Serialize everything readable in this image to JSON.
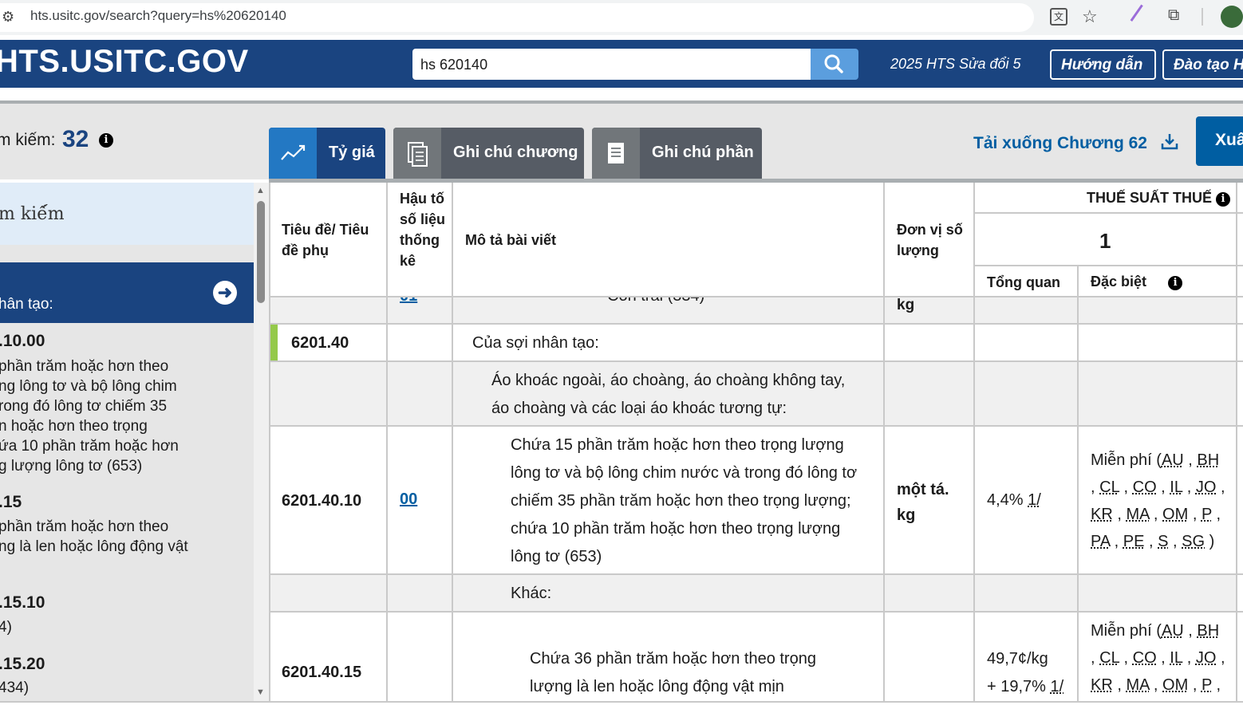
{
  "browser": {
    "url": "hts.usitc.gov/search?query=hs%20620140"
  },
  "header": {
    "logo": "HTS.USITC.GOV",
    "search_value": "hs 620140",
    "edition": "2025 HTS Sửa đổi 5",
    "buttons": [
      "Hướng dẫn",
      "Đào tạo H"
    ]
  },
  "results": {
    "label": "m kiếm:",
    "count": "32"
  },
  "tabs": {
    "rates": "Tỷ giá",
    "chapter_notes": "Ghi chú chương",
    "section_notes": "Ghi chú phần"
  },
  "download": "Tải xuống Chương 62",
  "export_label": "Xuấ",
  "sidebar": {
    "search_label": "m kiế́m",
    "band_label": "hân tạo:",
    "entries": [
      {
        "code": ".10.00",
        "desc": [
          "phần trăm hoặc hơn theo",
          "ng lông tơ và bộ lông chim",
          "rong đó lông tơ chiếm 35",
          "n hoặc hơn theo trọng",
          "ứa 10 phần trăm hoặc hơn",
          "g lượng lông tơ (653)"
        ]
      },
      {
        "code": ".15",
        "desc": [
          "phần trăm hoặc hơn theo",
          "ng là len hoặc lông động vật"
        ]
      },
      {
        "code": ".15.10",
        "desc": [
          "4)"
        ]
      },
      {
        "code": ".15.20",
        "desc": [
          "434)"
        ]
      }
    ]
  },
  "table": {
    "headers": {
      "heading": "Tiêu đề/ Tiêu đề phụ",
      "suffix": "Hậu tố số liệu thống kê",
      "description": "Mô tả bài viết",
      "unit": "Đơn vị số lượng",
      "rates": "THUẾ SUẤT THUẾ",
      "column1": "1",
      "general": "Tổng quan",
      "special": "Đặc biệt"
    },
    "partial_row": {
      "suffix": "01",
      "description": "Con trai (334)",
      "unit": "kg"
    },
    "rows": [
      {
        "heading": "6201.40",
        "description": "Của sợi nhân tạo:"
      },
      {
        "description_lines": [
          "Áo khoác ngoài, áo choàng, áo choàng không tay,",
          "áo choàng và các loại áo khoác tương tự:"
        ]
      },
      {
        "heading": "6201.40.10",
        "suffix": "00",
        "description_lines": [
          "Chứa 15 phần trăm hoặc hơn theo trọng lượng",
          "lông tơ và bộ lông chim nước và trong đó lông tơ",
          "chiếm 35 phần trăm hoặc hơn theo trọng lượng;",
          "chứa 10 phần trăm hoặc hơn theo trọng lượng",
          "lông tơ (653)"
        ],
        "unit_lines": [
          "một tá.",
          "kg"
        ],
        "general": "4,4%",
        "general_note": "1/",
        "special_prefix": "Miễn phí (",
        "special_codes": [
          "AU",
          "BH",
          "CL",
          "CO",
          "IL",
          "JO",
          "KR",
          "MA",
          "OM",
          "P",
          "PA",
          "PE",
          "S",
          "SG"
        ]
      },
      {
        "description": "Khác:"
      },
      {
        "heading": "6201.40.15",
        "description_lines": [
          "Chứa 36 phần trăm hoặc hơn theo trọng",
          "lượng là len hoặc lông động vật mịn"
        ],
        "general_lines": [
          "49,7¢/kg",
          "+ 19,7%"
        ],
        "general_note": "1/",
        "special_prefix": "Miễn phí (",
        "special_codes": [
          "AU",
          "BH",
          "CL",
          "CO",
          "IL",
          "JO",
          "KR",
          "MA",
          "OM",
          "P"
        ]
      }
    ]
  }
}
